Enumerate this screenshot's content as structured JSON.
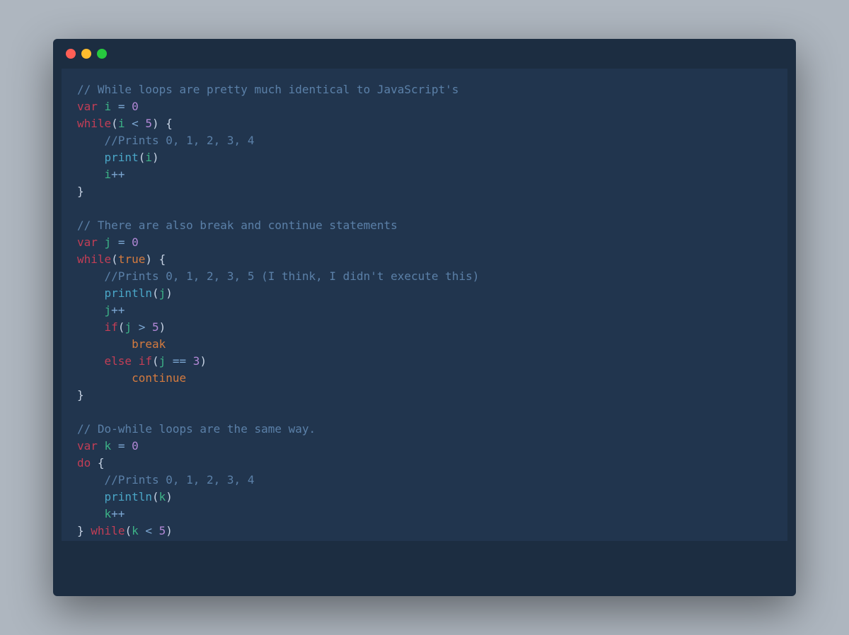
{
  "window": {
    "controls": {
      "close": "red",
      "minimize": "yellow",
      "zoom": "green"
    }
  },
  "code": {
    "c1": "// While loops are pretty much identical to JavaScript's",
    "var": "var",
    "while": "while",
    "if": "if",
    "else": "else",
    "do": "do",
    "break": "break",
    "continue": "continue",
    "print": "print",
    "println": "println",
    "true": "true",
    "id_i": "i",
    "id_j": "j",
    "id_k": "k",
    "n0": "0",
    "n5": "5",
    "n3": "3",
    "eq": "=",
    "lt": "<",
    "gt": ">",
    "eqeq": "==",
    "pp": "++",
    "lb": "{",
    "rb": "}",
    "lp": "(",
    "rp": ")",
    "c2": "//Prints 0, 1, 2, 3, 4",
    "c3": "// There are also break and continue statements",
    "c4": "//Prints 0, 1, 2, 3, 5 (I think, I didn't execute this)",
    "c5": "// Do-while loops are the same way.",
    "c6": "//Prints 0, 1, 2, 3, 4"
  }
}
